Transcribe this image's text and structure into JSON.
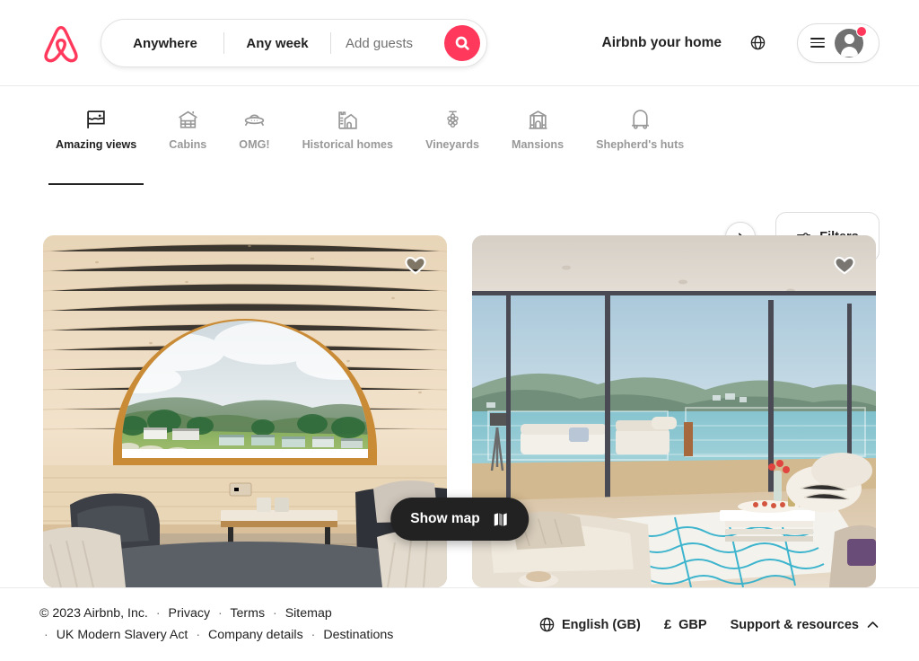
{
  "header": {
    "logo": "airbnb-belo-logo",
    "brand_color": "#FF385C",
    "search": {
      "where_label": "Anywhere",
      "when_label": "Any week",
      "guests_placeholder": "Add guests",
      "search_icon": "search-icon"
    },
    "host_link": "Airbnb your home",
    "globe_icon": "globe-icon",
    "menu_icon": "hamburger-menu-icon",
    "avatar_icon": "user-avatar-icon",
    "has_notification": true
  },
  "categories": {
    "next_label": "›",
    "items": [
      {
        "label": "Amazing views",
        "icon": "amazing-views-icon",
        "active": true
      },
      {
        "label": "Cabins",
        "icon": "cabin-icon",
        "active": false
      },
      {
        "label": "OMG!",
        "icon": "ufo-icon",
        "active": false
      },
      {
        "label": "Historical homes",
        "icon": "castle-icon",
        "active": false
      },
      {
        "label": "Vineyards",
        "icon": "grapes-icon",
        "active": false
      },
      {
        "label": "Mansions",
        "icon": "mansion-icon",
        "active": false
      },
      {
        "label": "Shepherd's huts",
        "icon": "hut-icon",
        "active": false
      }
    ],
    "filters": {
      "label": "Filters",
      "icon": "sliders-icon"
    }
  },
  "listings": [
    {
      "image_description": "Glamping pod interior with arched pine ceiling and large arched window overlooking green hills and a holiday park",
      "favourite_icon": "heart-icon",
      "favourited": false
    },
    {
      "image_description": "Modern living room with floor-to-ceiling glass doors opening onto a terrace above a blue estuary, white sofas and patterned rug",
      "favourite_icon": "heart-icon",
      "favourited": false
    }
  ],
  "show_map": {
    "label": "Show map",
    "icon": "map-icon"
  },
  "footer": {
    "copyright": "© 2023 Airbnb, Inc.",
    "links_line1": [
      "Privacy",
      "Terms",
      "Sitemap"
    ],
    "links_line2": [
      "UK Modern Slavery Act",
      "Company details",
      "Destinations"
    ],
    "separator": "·",
    "language": {
      "label": "English (GB)",
      "icon": "globe-icon"
    },
    "currency": {
      "symbol": "£",
      "code": "GBP"
    },
    "support": {
      "label": "Support & resources",
      "icon": "chevron-up-icon"
    }
  }
}
